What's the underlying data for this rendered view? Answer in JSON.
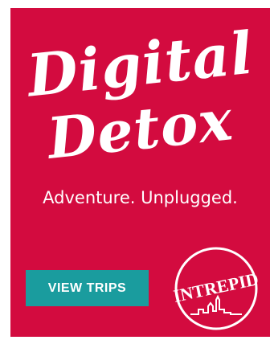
{
  "ad": {
    "title_line1": "Digital",
    "title_line2": "Detox",
    "tagline": "Adventure. Unplugged.",
    "cta_label": "VIEW TRIPS",
    "brand": "INTREPID",
    "colors": {
      "background": "#d30b3f",
      "button": "#1a9c9e",
      "text": "#ffffff"
    }
  }
}
